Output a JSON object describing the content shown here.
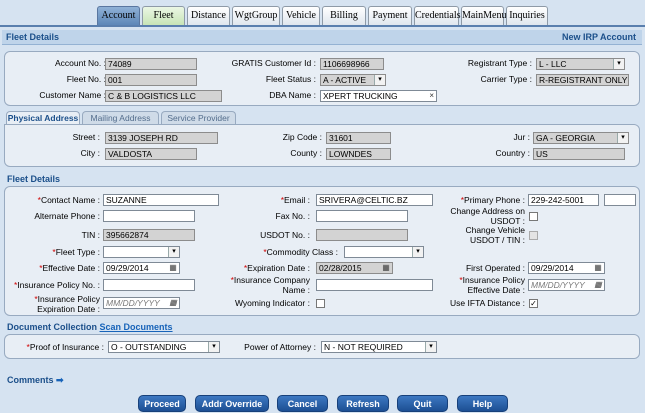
{
  "tabs": [
    "Account",
    "Fleet",
    "Distance",
    "WgtGroup",
    "Vehicle",
    "Billing",
    "Payment",
    "Credentials",
    "MainMenu",
    "Inquiries"
  ],
  "header": {
    "title": "Fleet Details",
    "right": "New IRP Account"
  },
  "account": {
    "account_no_label": "Account No. :",
    "account_no": "74089",
    "gratis_label": "GRATIS Customer Id :",
    "gratis": "1106698966",
    "registrant_type_label": "Registrant Type :",
    "registrant_type": "L - LLC",
    "fleet_no_label": "Fleet No. :",
    "fleet_no": "001",
    "fleet_status_label": "Fleet Status :",
    "fleet_status": "A - ACTIVE",
    "carrier_type_label": "Carrier Type :",
    "carrier_type": "R-REGISTRANT ONLY",
    "customer_name_label": "Customer Name :",
    "customer_name": "C & B LOGISTICS LLC",
    "dba_label": "DBA Name :",
    "dba": "XPERT TRUCKING",
    "clear_glyph": "×"
  },
  "address_tabs": [
    "Physical Address",
    "Mailing Address",
    "Service Provider"
  ],
  "address": {
    "street_label": "Street :",
    "street": "3139 JOSEPH RD",
    "zip_label": "Zip Code :",
    "zip": "31601",
    "jur_label": "Jur :",
    "jur": "GA - GEORGIA",
    "city_label": "City :",
    "city": "VALDOSTA",
    "county_label": "County :",
    "county": "LOWNDES",
    "country_label": "Country :",
    "country": "US"
  },
  "fleet_details": {
    "section_title": "Fleet Details",
    "contact_name_label": "Contact Name :",
    "contact_name": "SUZANNE",
    "email_label": "Email :",
    "email": "SRIVERA@CELTIC.BZ",
    "primary_phone_label": "Primary Phone :",
    "primary_phone": "229-242-5001",
    "alt_phone_label": "Alternate Phone :",
    "fax_label": "Fax No. :",
    "change_address_label_1": "Change Address on",
    "change_address_label_2": "USDOT :",
    "tin_label": "TIN :",
    "tin": "395662874",
    "usdot_label": "USDOT No. :",
    "change_vehicle_label_1": "Change Vehicle",
    "change_vehicle_label_2": "USDOT / TIN :",
    "fleet_type_label": "Fleet Type :",
    "commodity_label": "Commodity Class :",
    "effective_date_label": "Effective Date :",
    "effective_date": "09/29/2014",
    "expiration_date_label": "Expiration Date :",
    "expiration_date": "02/28/2015",
    "first_operated_label": "First Operated :",
    "first_operated": "09/29/2014",
    "ins_policy_label": "Insurance Policy No. :",
    "ins_company_label_1": "Insurance Company",
    "ins_company_label_2": "Name :",
    "ins_eff_label_1": "Insurance Policy",
    "ins_eff_label_2": "Effective Date :",
    "ins_exp_label_1": "Insurance Policy",
    "ins_exp_label_2": "Expiration Date :",
    "date_placeholder": "MM/DD/YYYY",
    "wyoming_label": "Wyoming Indicator :",
    "ifta_label": "Use IFTA Distance :",
    "check_glyph": "✓",
    "asterisk": "*"
  },
  "documents": {
    "section_title": "Document Collection",
    "scan_link": "Scan Documents",
    "proof_label": "Proof of Insurance :",
    "proof_value": "O - OUTSTANDING",
    "poa_label": "Power of Attorney :",
    "poa_value": "N - NOT REQUIRED"
  },
  "comments": {
    "label": "Comments",
    "arrow": "➡"
  },
  "buttons": [
    "Proceed",
    "Addr Override",
    "Cancel",
    "Refresh",
    "Quit",
    "Help"
  ],
  "icons": {
    "dropdown": "▾",
    "calendar": "▦"
  }
}
